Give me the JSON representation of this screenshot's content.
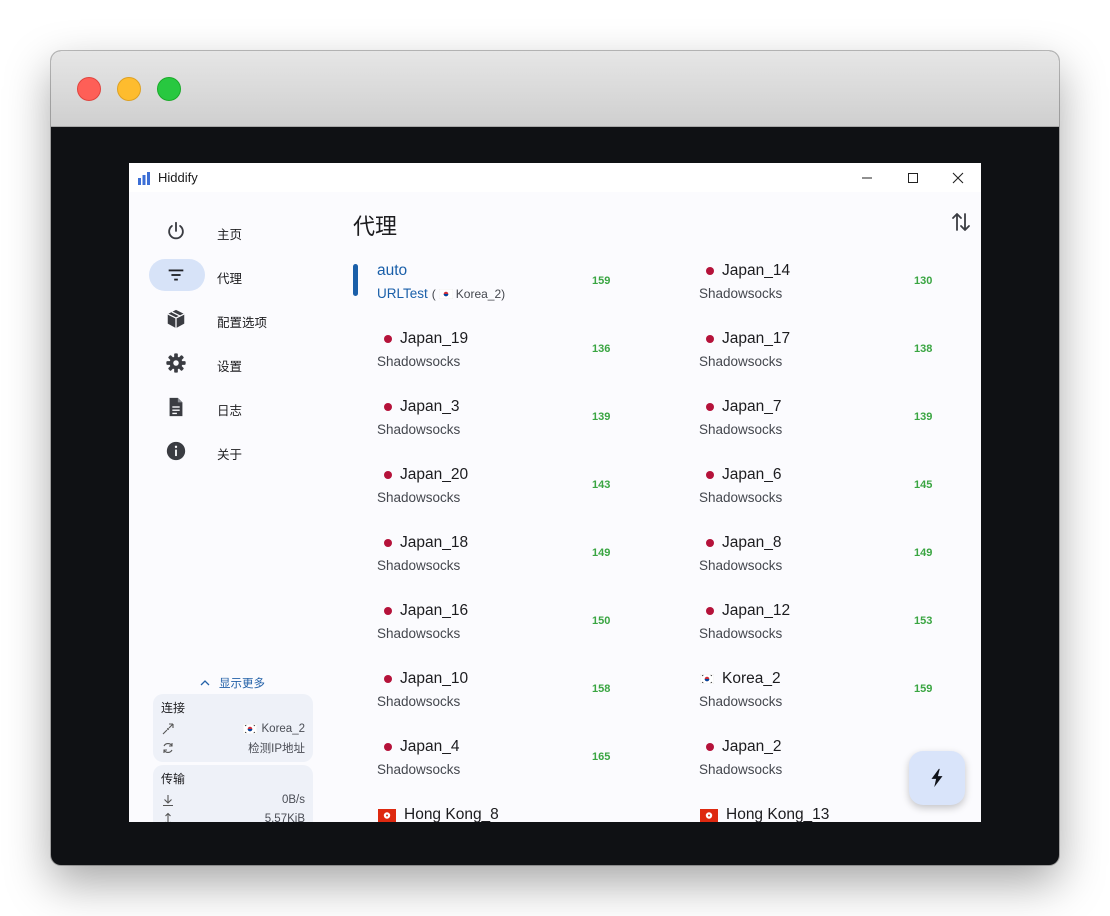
{
  "app": {
    "title": "Hiddify"
  },
  "sidebar": {
    "items": [
      {
        "label": "主页",
        "icon": "power-icon",
        "active": false
      },
      {
        "label": "代理",
        "icon": "filter-icon",
        "active": true
      },
      {
        "label": "配置选项",
        "icon": "package-icon",
        "active": false
      },
      {
        "label": "设置",
        "icon": "gear-icon",
        "active": false
      },
      {
        "label": "日志",
        "icon": "document-icon",
        "active": false
      },
      {
        "label": "关于",
        "icon": "info-icon",
        "active": false
      }
    ],
    "show_more": "显示更多",
    "connection": {
      "title": "连接",
      "outbound": "Korea_2",
      "ip_check": "检测IP地址"
    },
    "traffic": {
      "title": "传输",
      "speed": "0B/s",
      "total": "5.57KiB"
    }
  },
  "main": {
    "title": "代理",
    "proxies": [
      {
        "name": "auto",
        "type": "URLTest",
        "via": "Korea_2",
        "delay": "159",
        "flag": "none",
        "selected": true
      },
      {
        "name": "Japan_14",
        "type": "Shadowsocks",
        "delay": "130",
        "flag": "jp"
      },
      {
        "name": "Japan_19",
        "type": "Shadowsocks",
        "delay": "136",
        "flag": "jp"
      },
      {
        "name": "Japan_17",
        "type": "Shadowsocks",
        "delay": "138",
        "flag": "jp"
      },
      {
        "name": "Japan_3",
        "type": "Shadowsocks",
        "delay": "139",
        "flag": "jp"
      },
      {
        "name": "Japan_7",
        "type": "Shadowsocks",
        "delay": "139",
        "flag": "jp"
      },
      {
        "name": "Japan_20",
        "type": "Shadowsocks",
        "delay": "143",
        "flag": "jp"
      },
      {
        "name": "Japan_6",
        "type": "Shadowsocks",
        "delay": "145",
        "flag": "jp"
      },
      {
        "name": "Japan_18",
        "type": "Shadowsocks",
        "delay": "149",
        "flag": "jp"
      },
      {
        "name": "Japan_8",
        "type": "Shadowsocks",
        "delay": "149",
        "flag": "jp"
      },
      {
        "name": "Japan_16",
        "type": "Shadowsocks",
        "delay": "150",
        "flag": "jp"
      },
      {
        "name": "Japan_12",
        "type": "Shadowsocks",
        "delay": "153",
        "flag": "jp"
      },
      {
        "name": "Japan_10",
        "type": "Shadowsocks",
        "delay": "158",
        "flag": "jp"
      },
      {
        "name": "Korea_2",
        "type": "Shadowsocks",
        "delay": "159",
        "flag": "kr"
      },
      {
        "name": "Japan_4",
        "type": "Shadowsocks",
        "delay": "165",
        "flag": "jp"
      },
      {
        "name": "Japan_2",
        "type": "Shadowsocks",
        "delay": "",
        "flag": "jp"
      },
      {
        "name": "Hong Kong_8",
        "type": "",
        "delay": "",
        "flag": "hk"
      },
      {
        "name": "Hong Kong_13",
        "type": "",
        "delay": "",
        "flag": "hk"
      }
    ]
  },
  "colors": {
    "accent": "#1a5fa9",
    "delay_good": "#3aa542",
    "nav_active": "#d7e3f8",
    "fab": "#d9e4fa"
  }
}
